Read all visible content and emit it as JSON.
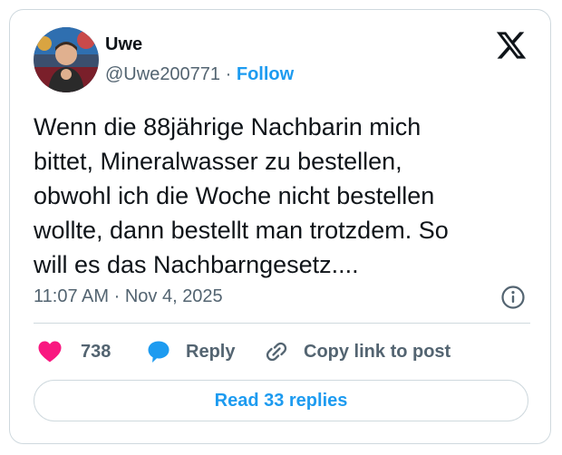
{
  "author": {
    "display_name": "Uwe",
    "handle": "@Uwe200771",
    "separator": "·",
    "follow_label": "Follow"
  },
  "tweet": {
    "text_lines": [
      "Wenn die 88jährige Nachbarin mich",
      "bittet, Mineralwasser zu bestellen,",
      "obwohl ich die Woche nicht bestellen",
      "wollte, dann bestellt man trotzdem. So",
      "will es das Nachbarngesetz...."
    ],
    "time": "11:07 AM",
    "separator": "·",
    "date": "Nov 4, 2025"
  },
  "actions": {
    "like_count": "738",
    "reply_label": "Reply",
    "copy_link_label": "Copy link to post"
  },
  "footer": {
    "read_replies_label": "Read 33 replies"
  },
  "icons": {
    "brand": "x-logo-icon",
    "info": "info-icon",
    "like": "heart-icon",
    "reply": "speech-bubble-icon",
    "copy": "link-icon"
  },
  "colors": {
    "accent": "#1d9bf0",
    "like": "#f91880",
    "secondary_text": "#536471",
    "border": "#cfd9de"
  }
}
